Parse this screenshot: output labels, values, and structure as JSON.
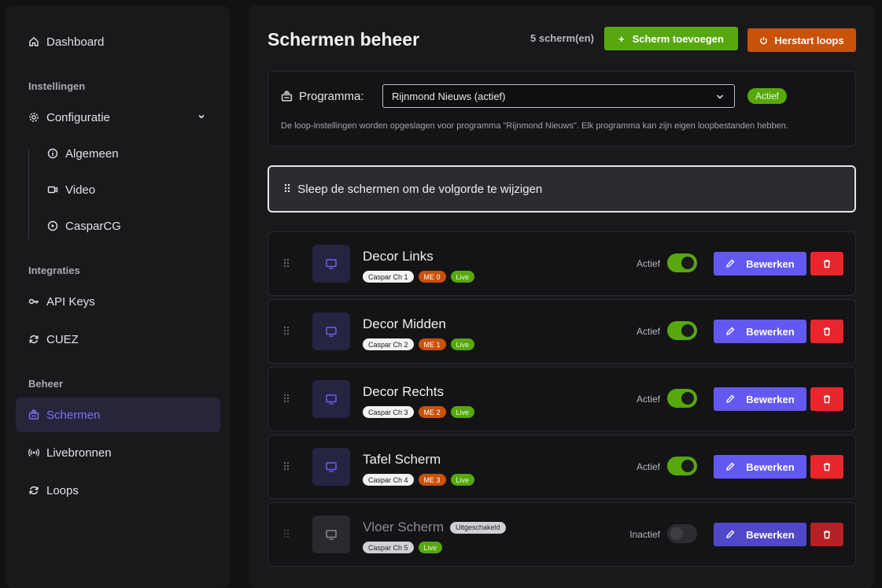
{
  "sidebar": {
    "dashboard": "Dashboard",
    "section_settings": "Instellingen",
    "configuratie": "Configuratie",
    "sub": [
      "Algemeen",
      "Video",
      "CasparCG"
    ],
    "section_integrations": "Integraties",
    "api_keys": "API Keys",
    "cuez": "CUEZ",
    "section_manage": "Beheer",
    "schermen": "Schermen",
    "livebronnen": "Livebronnen",
    "loops": "Loops"
  },
  "header": {
    "title": "Schermen beheer",
    "count": "5 scherm(en)",
    "add_button": "Scherm toevoegen",
    "restart_button": "Herstart loops"
  },
  "program": {
    "label": "Programma:",
    "selected": "Rijnmond Nieuws (actief)",
    "badge": "Actief",
    "note": "De loop-instellingen worden opgeslagen voor programma \"Rijnmond Nieuws\". Elk programma kan zijn eigen loopbestanden hebben."
  },
  "drag_hint": "Sleep de schermen om de volgorde te wijzigen",
  "edit_label": "Bewerken",
  "screens": [
    {
      "name": "Decor Links",
      "caspar": "Caspar Ch 1",
      "me": "ME 0",
      "live": "Live",
      "status": "Actief"
    },
    {
      "name": "Decor Midden",
      "caspar": "Caspar Ch 2",
      "me": "ME 1",
      "live": "Live",
      "status": "Actief"
    },
    {
      "name": "Decor Rechts",
      "caspar": "Caspar Ch 3",
      "me": "ME 2",
      "live": "Live",
      "status": "Actief"
    },
    {
      "name": "Tafel Scherm",
      "caspar": "Caspar Ch 4",
      "me": "ME 3",
      "live": "Live",
      "status": "Actief"
    },
    {
      "name": "Vloer Scherm",
      "disabled_badge": "Uitgeschakeld",
      "caspar": "Caspar Ch 5",
      "live": "Live",
      "status": "Inactief"
    }
  ],
  "colors": {
    "accent": "#6359f2",
    "green": "#57a80e",
    "orange": "#c9520a",
    "red": "#e8262c"
  }
}
